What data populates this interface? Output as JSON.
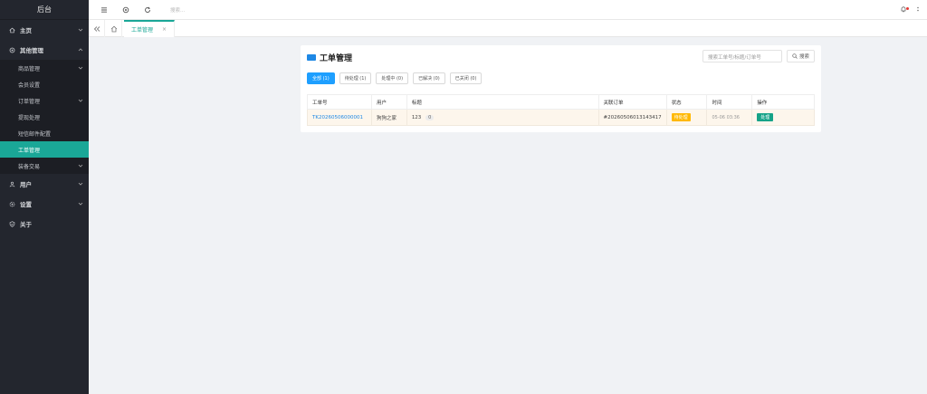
{
  "sidebar": {
    "title": "后台",
    "items": [
      {
        "label": "主页",
        "icon": "home-icon"
      },
      {
        "label": "其他管理",
        "icon": "gear-circle-icon"
      },
      {
        "label": "用户",
        "icon": "user-icon"
      },
      {
        "label": "设置",
        "icon": "settings-icon"
      },
      {
        "label": "关于",
        "icon": "shield-check-icon"
      }
    ],
    "subitems": [
      {
        "label": "商品管理"
      },
      {
        "label": "会员设置"
      },
      {
        "label": "订单管理"
      },
      {
        "label": "提现处理"
      },
      {
        "label": "短信邮件配置"
      },
      {
        "label": "工单管理"
      },
      {
        "label": "装备交易"
      }
    ]
  },
  "topbar": {
    "search_placeholder": "搜索..."
  },
  "tabs": {
    "active_tab": "工单管理",
    "close_glyph": "×"
  },
  "card": {
    "title": "工单管理",
    "search_placeholder": "搜索工单号/标题/订单号",
    "search_button": "搜索",
    "filters": [
      {
        "label": "全部 (1)",
        "active": true
      },
      {
        "label": "待处理 (1)"
      },
      {
        "label": "处理中 (0)"
      },
      {
        "label": "已解决 (0)"
      },
      {
        "label": "已关闭 (0)"
      }
    ],
    "table": {
      "headers": [
        "工单号",
        "用户",
        "标题",
        "关联订单",
        "状态",
        "时间",
        "操作"
      ],
      "rows": [
        {
          "ticket_no": "TK20260506000001",
          "user": "狗狗之家",
          "title": "123",
          "reply_count": "0",
          "order": "#20260506013143417",
          "status": "待处理",
          "time": "05-06 03:36",
          "action": "处理"
        }
      ]
    }
  },
  "colors": {
    "sidebar_bg": "#23262e",
    "accent": "#1aa797",
    "filter_active": "#1e9fff",
    "status_pending": "#ffb800",
    "link": "#1e88e5"
  }
}
